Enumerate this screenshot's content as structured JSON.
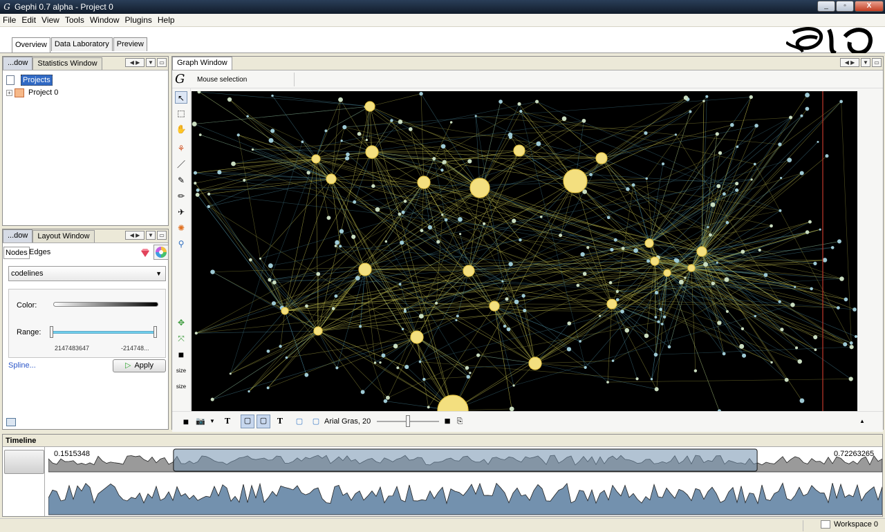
{
  "window": {
    "title": "Gephi 0.7 alpha - Project 0",
    "min": "_",
    "max": "▫",
    "close": "X"
  },
  "menu": [
    "File",
    "Edit",
    "View",
    "Tools",
    "Window",
    "Plugins",
    "Help"
  ],
  "perspectives": {
    "tabs": [
      "Overview",
      "Data Laboratory",
      "Preview"
    ],
    "active": "Overview"
  },
  "projects_panel": {
    "tabs": [
      "...dow",
      "Statistics Window"
    ],
    "root_label": "Projects",
    "expander": "+",
    "items": [
      "Project 0"
    ]
  },
  "ranking_panel": {
    "tabs": [
      "...dow",
      "Layout Window"
    ],
    "subtabs": [
      "Nodes",
      "Edges"
    ],
    "selected_attribute": "codelines",
    "color_label": "Color:",
    "range_label": "Range:",
    "range_min": "2147483647",
    "range_max": "-214748...",
    "range_low": 0.0,
    "range_high": 1.0,
    "spline_label": "Spline...",
    "apply_label": "Apply"
  },
  "graph_window": {
    "tab": "Graph Window",
    "mode_label": "Mouse selection",
    "size_label_1": "size",
    "size_label_2": "size",
    "font_label": "Arial Gras, 20",
    "font_size_level": 0.5
  },
  "timeline": {
    "title": "Timeline",
    "min_label": "0.1515348",
    "max_label": "0.72263265",
    "selection_start": 0.15,
    "selection_end": 0.85
  },
  "status": {
    "workspace": "Workspace 0"
  },
  "colors": {
    "node_fill": "#f3df7f",
    "node_stroke": "#e8c84a",
    "edge_yellow": "#b8b54a",
    "edge_blue": "#4e8ea2",
    "timeline_fill": "#7391ae",
    "timeline_grey": "#9a9a9a",
    "selection_blue": "#316ac5"
  }
}
